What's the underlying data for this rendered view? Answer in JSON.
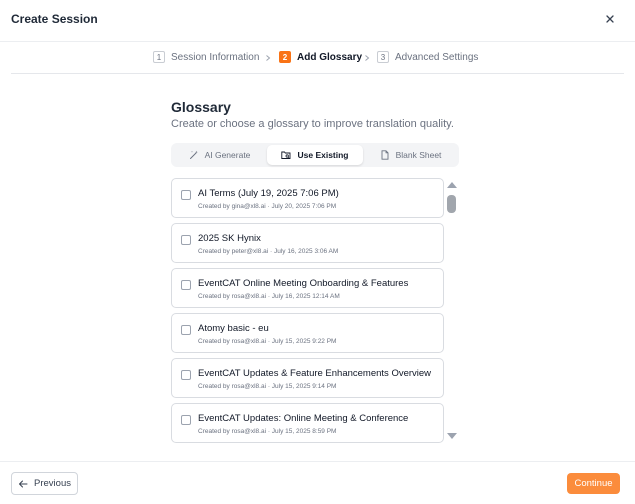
{
  "dialog": {
    "title": "Create Session"
  },
  "stepper": {
    "steps": [
      {
        "number": "1",
        "label": "Session Information"
      },
      {
        "number": "2",
        "label": "Add Glossary"
      },
      {
        "number": "3",
        "label": "Advanced Settings"
      }
    ],
    "active_step": 2,
    "accent_color": "#f97316"
  },
  "glossary": {
    "title": "Glossary",
    "subtitle": "Create or choose a glossary to improve translation quality.",
    "tabs": [
      {
        "label": "AI Generate",
        "icon": "magic-wand-icon"
      },
      {
        "label": "Use Existing",
        "icon": "folder-search-icon"
      },
      {
        "label": "Blank Sheet",
        "icon": "document-icon"
      }
    ],
    "active_tab": "Use Existing",
    "items": [
      {
        "name": "AI Terms (July 19, 2025 7:06 PM)",
        "meta": "Created by gina@xl8.ai · July 20, 2025 7:06 PM"
      },
      {
        "name": "2025 SK Hynix",
        "meta": "Created by peter@xl8.ai · July 16, 2025 3:06 AM"
      },
      {
        "name": "EventCAT Online Meeting Onboarding & Features",
        "meta": "Created by rosa@xl8.ai · July 16, 2025 12:14 AM"
      },
      {
        "name": "Atomy basic - eu",
        "meta": "Created by rosa@xl8.ai · July 15, 2025 9:22 PM"
      },
      {
        "name": "EventCAT Updates & Feature Enhancements Overview",
        "meta": "Created by rosa@xl8.ai · July 15, 2025 9:14 PM"
      },
      {
        "name": "EventCAT Updates: Online Meeting & Conference",
        "meta": "Created by rosa@xl8.ai · July 15, 2025 8:59 PM"
      }
    ]
  },
  "footer": {
    "previous_label": "Previous",
    "continue_label": "Continue",
    "continue_color": "#fb8c3c"
  }
}
